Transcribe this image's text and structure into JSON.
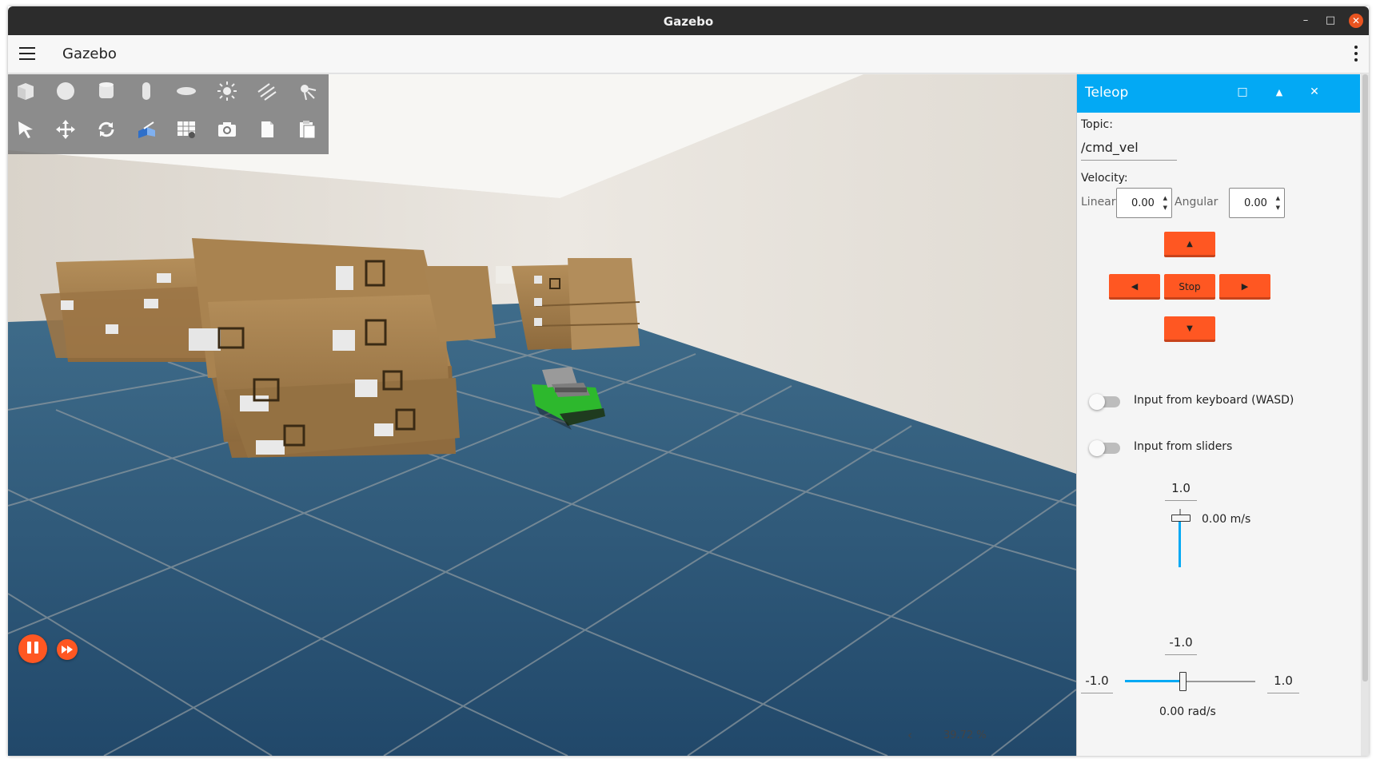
{
  "window": {
    "title": "Gazebo",
    "minimize": "–",
    "maximize": "□",
    "close": "✕"
  },
  "appbar": {
    "title": "Gazebo",
    "menu_icon": "hamburger-menu-icon",
    "overflow_icon": "kebab-menu-icon"
  },
  "toolbar": {
    "row1": [
      "box-shape-icon",
      "sphere-shape-icon",
      "cylinder-shape-icon",
      "capsule-shape-icon",
      "ellipsoid-shape-icon",
      "point-light-icon",
      "directional-light-icon",
      "spot-light-icon"
    ],
    "row2": [
      "select-icon",
      "translate-icon",
      "rotate-icon",
      "scale-icon",
      "grid-snap-icon",
      "screenshot-camera-icon",
      "copy-icon",
      "paste-icon"
    ]
  },
  "playback": {
    "pause_icon": "pause-icon",
    "step_icon": "fast-forward-icon",
    "rtf_arrow": "‹",
    "rtf": "39.72 %"
  },
  "teleop": {
    "title": "Teleop",
    "header_buttons": [
      "□",
      "▲",
      "✕"
    ],
    "topic_label": "Topic:",
    "topic_value": "/cmd_vel",
    "velocity_label": "Velocity:",
    "linear_label": "Linear",
    "linear_value": "0.00",
    "angular_label": "Angular",
    "angular_value": "0.00",
    "up": "▲",
    "left": "◀",
    "stop": "Stop",
    "right": "▶",
    "down": "▼",
    "keyboard_toggle_label": "Input from keyboard (WASD)",
    "keyboard_toggle_on": false,
    "sliders_toggle_label": "Input from sliders",
    "sliders_toggle_on": false,
    "linear_max": "1.0",
    "linear_min": "-1.0",
    "linear_readout": "0.00 m/s",
    "linear_slider_value": 0.0,
    "angular_min": "-1.0",
    "angular_max": "1.0",
    "angular_readout": "0.00 rad/s",
    "angular_slider_value": 0.0
  },
  "colors": {
    "accent_blue": "#03a9f4",
    "accent_orange": "#ff5722",
    "titlebar": "#2c2c2c"
  }
}
